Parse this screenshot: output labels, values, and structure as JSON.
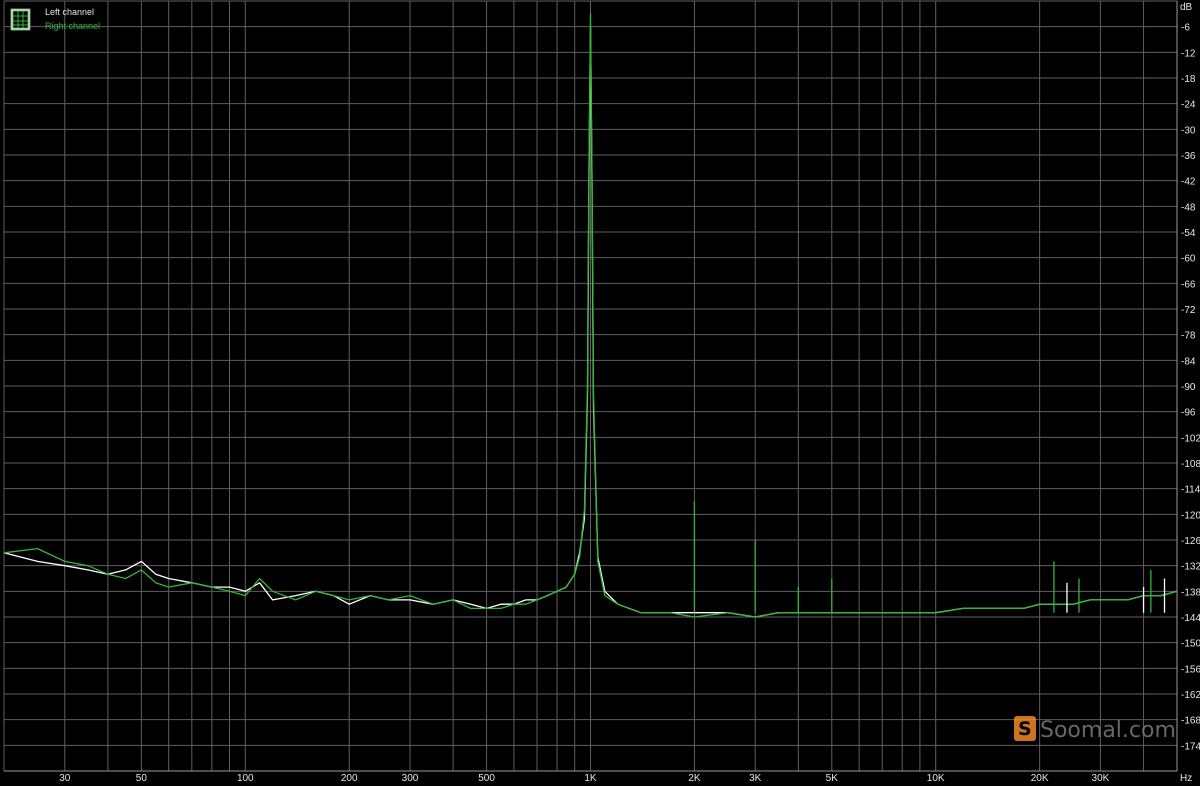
{
  "chart_data": {
    "type": "line",
    "title": "",
    "xlabel": "",
    "ylabel": "",
    "x_unit": "Hz",
    "y_unit": "dB",
    "x_scale": "log",
    "xlim": [
      20,
      50000
    ],
    "ylim": [
      -180,
      0
    ],
    "grid": true,
    "legend_position": "top-left",
    "x_tick_labels": [
      {
        "value": 30,
        "label": "30"
      },
      {
        "value": 50,
        "label": "50"
      },
      {
        "value": 100,
        "label": "100"
      },
      {
        "value": 200,
        "label": "200"
      },
      {
        "value": 300,
        "label": "300"
      },
      {
        "value": 500,
        "label": "500"
      },
      {
        "value": 1000,
        "label": "1K"
      },
      {
        "value": 2000,
        "label": "2K"
      },
      {
        "value": 3000,
        "label": "3K"
      },
      {
        "value": 5000,
        "label": "5K"
      },
      {
        "value": 10000,
        "label": "10K"
      },
      {
        "value": 20000,
        "label": "20K"
      },
      {
        "value": 30000,
        "label": "30K"
      }
    ],
    "y_tick_labels": [
      "-6",
      "-12",
      "-18",
      "-24",
      "-30",
      "-36",
      "-42",
      "-48",
      "-54",
      "-60",
      "-66",
      "-72",
      "-78",
      "-84",
      "-90",
      "-96",
      "-102",
      "-108",
      "-114",
      "-120",
      "-126",
      "-132",
      "-138",
      "-144",
      "-150",
      "-156",
      "-162",
      "-168",
      "-174"
    ],
    "series": [
      {
        "name": "Left channel",
        "color": "#ffffff",
        "x": [
          20,
          25,
          30,
          35,
          40,
          45,
          50,
          55,
          60,
          70,
          80,
          90,
          100,
          110,
          120,
          140,
          160,
          180,
          200,
          230,
          260,
          300,
          350,
          400,
          450,
          500,
          550,
          600,
          650,
          700,
          750,
          800,
          850,
          900,
          930,
          960,
          980,
          990,
          1000,
          1010,
          1020,
          1050,
          1100,
          1200,
          1400,
          1700,
          2000,
          2500,
          3000,
          3500,
          4000,
          4500,
          5000,
          6000,
          7000,
          8000,
          10000,
          12000,
          15000,
          18000,
          20000,
          22000,
          25000,
          28000,
          30000,
          33000,
          36000,
          40000,
          45000,
          50000
        ],
        "y": [
          -129,
          -131,
          -132,
          -133,
          -134,
          -133,
          -131,
          -134,
          -135,
          -136,
          -137,
          -137,
          -138,
          -136,
          -140,
          -139,
          -138,
          -139,
          -141,
          -139,
          -140,
          -140,
          -141,
          -140,
          -141,
          -142,
          -141,
          -141,
          -140,
          -140,
          -139,
          -138,
          -137,
          -134,
          -129,
          -121,
          -92,
          -40,
          -6,
          -42,
          -95,
          -130,
          -138,
          -141,
          -143,
          -143,
          -143,
          -143,
          -144,
          -143,
          -143,
          -143,
          -143,
          -143,
          -143,
          -143,
          -143,
          -142,
          -142,
          -142,
          -141,
          -141,
          -141,
          -140,
          -140,
          -140,
          -140,
          -139,
          -139,
          -138
        ]
      },
      {
        "name": "Right channel",
        "color": "#35b535",
        "x": [
          20,
          25,
          30,
          35,
          40,
          45,
          50,
          55,
          60,
          70,
          80,
          90,
          100,
          110,
          120,
          140,
          160,
          180,
          200,
          230,
          260,
          300,
          350,
          400,
          450,
          500,
          550,
          600,
          650,
          700,
          750,
          800,
          850,
          900,
          930,
          960,
          980,
          990,
          1000,
          1010,
          1020,
          1050,
          1100,
          1200,
          1400,
          1700,
          2000,
          2500,
          3000,
          3500,
          4000,
          4500,
          5000,
          6000,
          7000,
          8000,
          10000,
          12000,
          15000,
          18000,
          20000,
          22000,
          25000,
          28000,
          30000,
          33000,
          36000,
          40000,
          45000,
          50000
        ],
        "y": [
          -129,
          -128,
          -131,
          -132,
          -134,
          -135,
          -133,
          -136,
          -137,
          -136,
          -137,
          -138,
          -139,
          -135,
          -138,
          -140,
          -138,
          -139,
          -140,
          -139,
          -140,
          -139,
          -141,
          -140,
          -142,
          -142,
          -142,
          -141,
          -141,
          -140,
          -139,
          -138,
          -137,
          -134,
          -130,
          -119,
          -90,
          -38,
          -3,
          -40,
          -92,
          -131,
          -139,
          -141,
          -143,
          -143,
          -144,
          -143,
          -144,
          -143,
          -143,
          -143,
          -143,
          -143,
          -143,
          -143,
          -143,
          -142,
          -142,
          -142,
          -141,
          -141,
          -141,
          -140,
          -140,
          -140,
          -140,
          -139,
          -139,
          -138
        ]
      }
    ],
    "harmonic_spurs": [
      {
        "x": 2000,
        "y": -117,
        "color": "#35b535"
      },
      {
        "x": 3000,
        "y": -126,
        "color": "#35b535"
      },
      {
        "x": 4000,
        "y": -137,
        "color": "#35b535"
      },
      {
        "x": 5000,
        "y": -135,
        "color": "#35b535"
      },
      {
        "x": 22000,
        "y": -131,
        "color": "#35b535"
      },
      {
        "x": 24000,
        "y": -136,
        "color": "#ffffff"
      },
      {
        "x": 26000,
        "y": -135,
        "color": "#35b535"
      },
      {
        "x": 40000,
        "y": -137,
        "color": "#ffffff"
      },
      {
        "x": 42000,
        "y": -133,
        "color": "#35b535"
      },
      {
        "x": 46000,
        "y": -135,
        "color": "#ffffff"
      }
    ]
  },
  "legend": {
    "icon": "grid-icon",
    "items": [
      {
        "label": "Left channel",
        "color": "#e6e6e6"
      },
      {
        "label": "Right channel",
        "color": "#35b535"
      }
    ]
  },
  "watermark": {
    "text": "Soomal.com",
    "logo_letter": "S"
  },
  "colors": {
    "background": "#000000",
    "grid": "#5f5f5f",
    "axis_text": "#e6e6e6",
    "left_channel": "#ffffff",
    "right_channel": "#35b535",
    "watermark_orange": "#f08a24"
  }
}
